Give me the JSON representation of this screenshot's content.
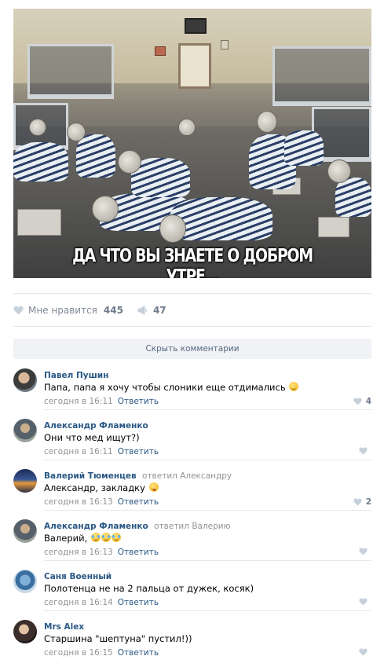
{
  "post": {
    "image_caption": "ДА ЧТО ВЫ ЗНАЕТЕ О ДОБРОМ УТРЕ..."
  },
  "actions": {
    "like_label": "Мне нравится",
    "like_count": "445",
    "share_count": "47",
    "like_icon": "heart-icon",
    "share_icon": "megaphone-icon"
  },
  "comments_toggle": "Скрыть комментарии",
  "comments": [
    {
      "author": "Павел Пушин",
      "replied_to": "",
      "text": "Папа, папа я хочу чтобы слоники еще отдимались",
      "emoji": [
        "grin"
      ],
      "time": "сегодня в 16:11",
      "reply_label": "Ответить",
      "likes": "4"
    },
    {
      "author": "Александр Фламенко",
      "replied_to": "",
      "text": "Они что мед ищут?)",
      "emoji": [],
      "time": "сегодня в 16:11",
      "reply_label": "Ответить",
      "likes": ""
    },
    {
      "author": "Валерий Тюменцев",
      "replied_label": "ответил",
      "replied_to": "Александру",
      "text": "Александр, закладку",
      "emoji": [
        "tongue"
      ],
      "time": "сегодня в 16:13",
      "reply_label": "Ответить",
      "likes": "2"
    },
    {
      "author": "Александр Фламенко",
      "replied_label": "ответил",
      "replied_to": "Валерию",
      "text": "Валерий,",
      "emoji": [
        "laugh",
        "laugh",
        "laugh"
      ],
      "time": "сегодня в 16:13",
      "reply_label": "Ответить",
      "likes": ""
    },
    {
      "author": "Саня Военный",
      "replied_to": "",
      "text": "Полотенца не на 2 пальца от дужек, косяк)",
      "emoji": [],
      "time": "сегодня в 16:14",
      "reply_label": "Ответить",
      "likes": ""
    },
    {
      "author": "Mrs Alex",
      "replied_to": "",
      "text": "Старшина \"шептуна\" пустил!))",
      "emoji": [],
      "time": "сегодня в 16:15",
      "reply_label": "Ответить",
      "likes": ""
    }
  ],
  "colors": {
    "link": "#2a5885",
    "muted": "#939393",
    "divider": "#e7e8ec",
    "button_bg": "#f0f2f5"
  }
}
